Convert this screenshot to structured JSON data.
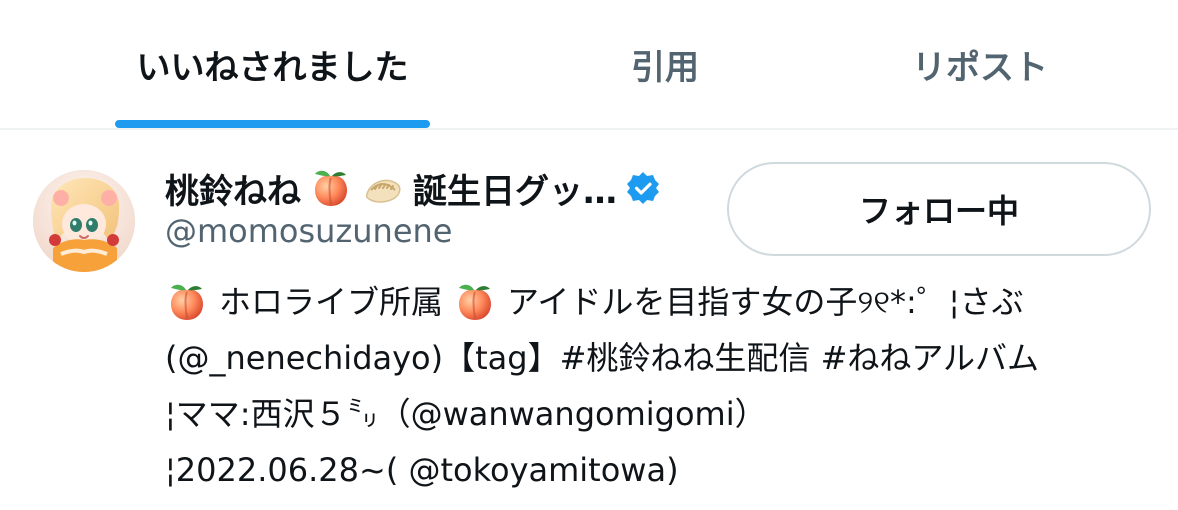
{
  "tabs": [
    {
      "label": "いいねされました",
      "active": true
    },
    {
      "label": "引用",
      "active": false
    },
    {
      "label": "リポスト",
      "active": false
    }
  ],
  "user": {
    "display_name": "桃鈴ねね",
    "display_name_suffix": "誕生日グッ…",
    "handle": "@momosuzunene",
    "verified": true,
    "follow_button_label": "フォロー中",
    "bio_lines": [
      {
        "prefix_icon": "peach-emoji",
        "text": "ホロライブ所属",
        "suffix_icon": "peach-emoji",
        "text2": "アイドルを目指す女の子୨୧*:゜¦さぶ"
      },
      {
        "text": "(@_nenechidayo)【tag】#桃鈴ねね生配信 #ねねアルバム"
      },
      {
        "text": "¦ママ:西沢５㍉（@wanwangomigomi）"
      },
      {
        "text": "¦2022.06.28~( @tokoyamitowa)"
      }
    ]
  },
  "colors": {
    "accent": "#1d9bf0",
    "text_primary": "#0f1419",
    "text_secondary": "#536471",
    "border": "#eff3f4",
    "button_border": "#cfd9de"
  },
  "icons": {
    "avatar": "avatar",
    "peach": "peach-emoji",
    "dumpling": "dumpling-emoji",
    "verified": "verified-badge-icon"
  }
}
